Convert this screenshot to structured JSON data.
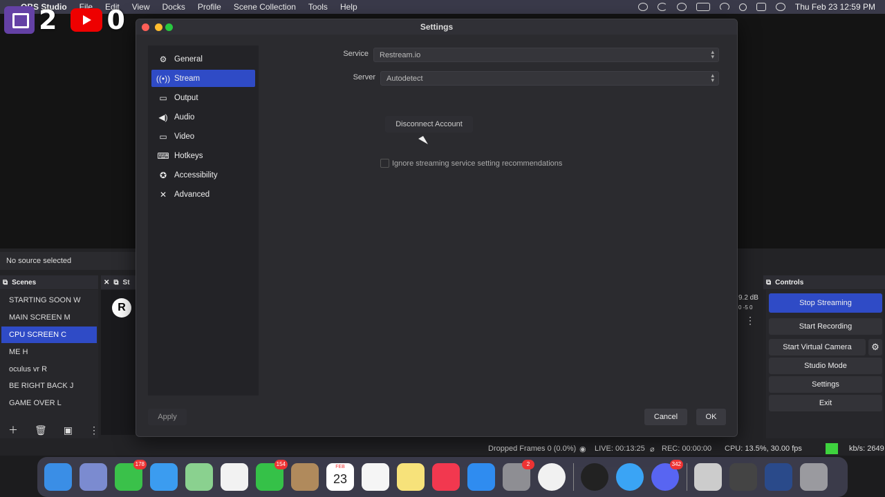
{
  "menubar": {
    "app_name": "OBS Studio",
    "items": [
      "File",
      "Edit",
      "View",
      "Docks",
      "Profile",
      "Scene Collection",
      "Tools",
      "Help"
    ],
    "datetime": "Thu Feb 23  12:59 PM"
  },
  "overlay": {
    "twitch_count": "2",
    "youtube_count": "0"
  },
  "obs": {
    "no_source": "No source selected",
    "scenes_title": "Scenes",
    "controls_title": "Controls",
    "scenes": [
      "STARTING SOON W",
      "MAIN SCREEN M",
      "CPU SCREEN C",
      "ME H",
      "oculus vr R",
      "BE RIGHT BACK J",
      "GAME OVER L"
    ],
    "active_scene": "CPU SCREEN C",
    "source_tab_partial": "St",
    "source_logo": "R",
    "audio_db": "9.2 dB",
    "audio_scale": "0  -5  0",
    "controls": {
      "stop_streaming": "Stop Streaming",
      "start_recording": "Start Recording",
      "start_virtual_camera": "Start Virtual Camera",
      "studio_mode": "Studio Mode",
      "settings": "Settings",
      "exit": "Exit"
    },
    "status": {
      "dropped": "Dropped Frames 0 (0.0%)",
      "live": "LIVE: 00:13:25",
      "rec": "REC: 00:00:00",
      "cpu": "CPU: 13.5%, 30.00 fps",
      "kbs": "kb/s: 2649"
    }
  },
  "settings": {
    "title": "Settings",
    "nav": [
      "General",
      "Stream",
      "Output",
      "Audio",
      "Video",
      "Hotkeys",
      "Accessibility",
      "Advanced"
    ],
    "nav_icons": [
      "gear-icon",
      "antenna-icon",
      "output-icon",
      "speaker-icon",
      "monitor-icon",
      "keyboard-icon",
      "accessibility-icon",
      "wrench-icon"
    ],
    "active_nav": "Stream",
    "service_label": "Service",
    "service_value": "Restream.io",
    "server_label": "Server",
    "server_value": "Autodetect",
    "disconnect_label": "Disconnect Account",
    "ignore_label": "Ignore streaming service setting recommendations",
    "apply_label": "Apply",
    "cancel_label": "Cancel",
    "ok_label": "OK"
  },
  "dock": {
    "badges": {
      "messages": "178",
      "facetime": "154",
      "system_settings": "2",
      "discord": "342"
    },
    "calendar": {
      "month": "FEB",
      "day": "23"
    }
  },
  "colors": {
    "accent": "#2f4bc6",
    "live_indicator": "#3ed23e"
  }
}
